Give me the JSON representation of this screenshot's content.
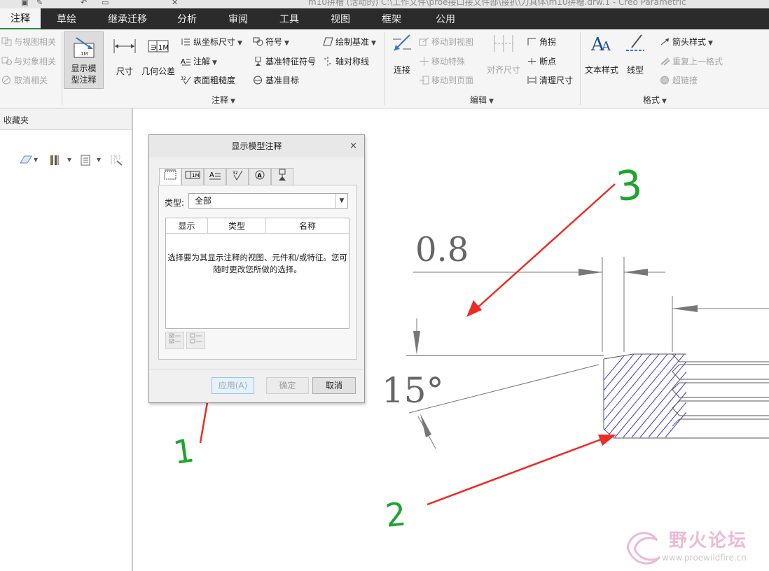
{
  "window": {
    "title": "m10拼槽 (活动的) C:\\工作文件\\proe接口接文件部\\接扒\\刀具体\\m10拼槽.drw.1 - Creo Parametric"
  },
  "menu": {
    "tabs": [
      {
        "label": "注释",
        "active": true
      },
      {
        "label": "草绘"
      },
      {
        "label": "继承迁移"
      },
      {
        "label": "分析"
      },
      {
        "label": "审阅"
      },
      {
        "label": "工具"
      },
      {
        "label": "视图"
      },
      {
        "label": "框架"
      },
      {
        "label": "公用"
      }
    ]
  },
  "ribbon": {
    "left_items": [
      "与视图相关",
      "与对象相关",
      "取消相关"
    ],
    "show_model_annotations": "显示模型注释",
    "dimension": "尺寸",
    "gtol": "几何公差",
    "ordinate_dim": "纵坐标尺寸",
    "note": "注解",
    "surface_finish": "表面粗糙度",
    "symbol": "符号",
    "datum_feature_symbol": "基准特征符号",
    "datum_target": "基准目标",
    "draw_datum": "绘制基准",
    "axis_symmetry": "轴对称线",
    "annotation_group": "注释",
    "connect": "连接",
    "move_to_view": "移动到视图",
    "move_special": "移动特殊",
    "move_to_page": "移动到页面",
    "align_dims": "对齐尺寸",
    "corner": "角拐",
    "breakpoint": "断点",
    "clean_dims": "清理尺寸",
    "edit_group": "编辑",
    "text_style": "文本样式",
    "line_style": "线型",
    "arrow_style": "箭头样式",
    "repeat_format": "重复上一格式",
    "hyperlink": "超链接",
    "format_group": "格式"
  },
  "left_panel": {
    "header": "收藏夹"
  },
  "dialog": {
    "title": "显示模型注释",
    "close": "×",
    "tabs": [
      "尺寸",
      "几何公差",
      "注解",
      "表面粗糙度",
      "符号",
      "基准"
    ],
    "type_label": "类型:",
    "type_value": "全部",
    "columns": [
      "显示",
      "类型",
      "名称"
    ],
    "message": "选择要为其显示注释的视图、元件和/或特征。您可随时更改您所做的选择。",
    "apply": "应用(A)",
    "ok": "确定",
    "cancel": "取消"
  },
  "drawing": {
    "dim_linear": "0.8",
    "dim_angle": "15°",
    "annotations": [
      "1",
      "2",
      "3"
    ],
    "colors": {
      "arrow": "#ee2b24",
      "handwriting": "#1ea52e",
      "hatch": "#3b3bd6",
      "geometry": "#555555"
    }
  },
  "watermark": {
    "name": "野火论坛",
    "url": "www.proewildfire.cn"
  }
}
